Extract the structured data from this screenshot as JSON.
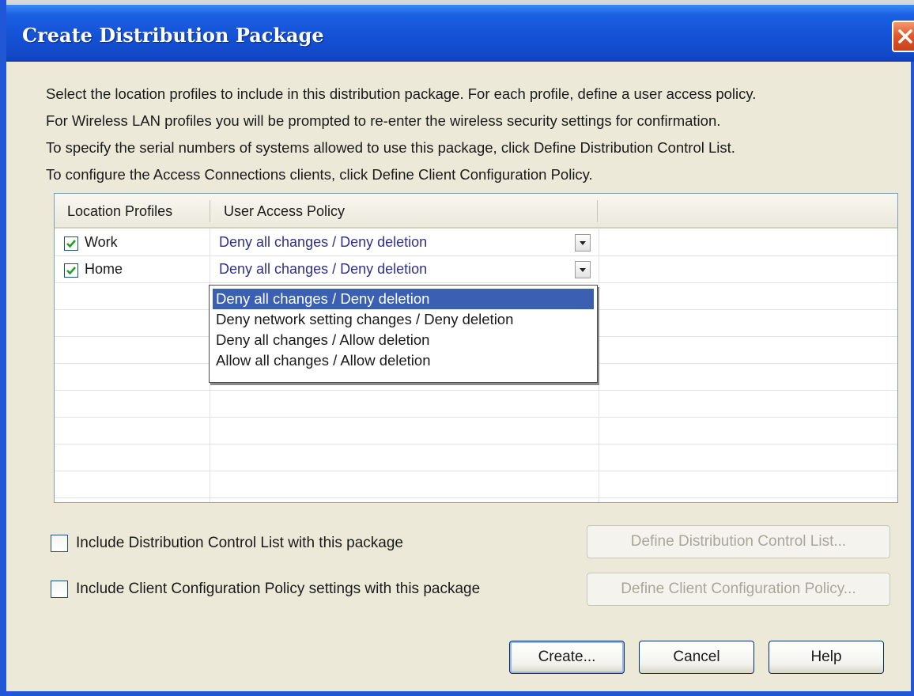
{
  "window": {
    "title": "Create Distribution Package"
  },
  "intro": [
    "Select the location profiles to include in this distribution package. For each profile, define a user access policy.",
    "For Wireless LAN profiles you will be prompted to re-enter the wireless security settings for confirmation.",
    "To specify the serial numbers of systems allowed to use this package, click Define Distribution Control List.",
    "To configure the Access Connections clients, click Define Client Configuration Policy."
  ],
  "list": {
    "columns": [
      "Location Profiles",
      "User Access Policy"
    ],
    "rows": [
      {
        "profile": "Work",
        "checked": true,
        "policy": "Deny all changes / Deny deletion"
      },
      {
        "profile": "Home",
        "checked": true,
        "policy": "Deny all changes / Deny deletion"
      }
    ]
  },
  "dropdown": {
    "selected_index": 0,
    "options": [
      "Deny all changes / Deny deletion",
      "Deny network setting changes / Deny deletion",
      "Deny all changes / Allow deletion",
      "Allow all changes / Allow deletion"
    ]
  },
  "options": {
    "include_dcl_label": "Include Distribution Control List with this package",
    "include_dcl_checked": false,
    "include_ccp_label": "Include Client Configuration Policy settings with this package",
    "include_ccp_checked": false
  },
  "buttons": {
    "define_dcl": "Define Distribution Control List...",
    "define_ccp": "Define Client Configuration Policy...",
    "create": "Create...",
    "cancel": "Cancel",
    "help": "Help"
  },
  "colors": {
    "title_bar": "#1450d4",
    "selection": "#3b5fb3",
    "policy_text": "#2f2f8e",
    "close_button": "#e0552a"
  },
  "icons": {
    "close": "close-icon",
    "dropdown": "chevron-down-icon",
    "checkmark": "checkmark-icon"
  }
}
